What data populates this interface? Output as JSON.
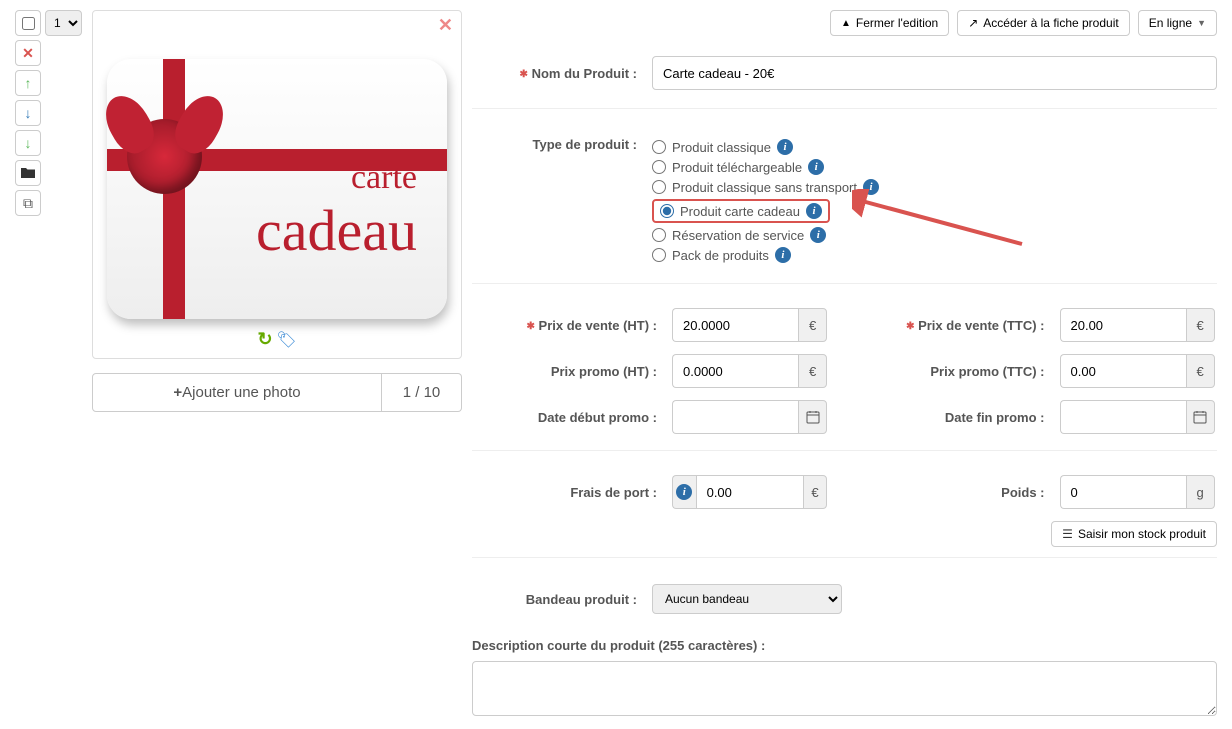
{
  "side": {
    "order_value": "1",
    "delete_icon": "✕",
    "up_icon": "↑",
    "down_icon": "↓",
    "down2_icon": "↓",
    "folder_icon": "■",
    "copy_icon": "⧉"
  },
  "toolbar": {
    "close_label": "Fermer l'edition",
    "goto_label": "Accéder à la fiche produit",
    "status_label": "En ligne"
  },
  "gallery": {
    "carte_text": "carte",
    "cadeau_text": "cadeau",
    "add_photo_label": "Ajouter une photo",
    "counter": "1 / 10"
  },
  "fields": {
    "name_label": "Nom du Produit :",
    "name_value": "Carte cadeau - 20€",
    "type_label": "Type de produit :",
    "radios": {
      "classic": "Produit classique",
      "download": "Produit téléchargeable",
      "notransport": "Produit classique sans transport",
      "giftcard": "Produit carte cadeau",
      "reservation": "Réservation de service",
      "pack": "Pack de produits"
    },
    "price_ht_label": "Prix de vente (HT) :",
    "price_ht_value": "20.0000",
    "price_ttc_label": "Prix de vente (TTC) :",
    "price_ttc_value": "20.00",
    "promo_ht_label": "Prix promo (HT) :",
    "promo_ht_value": "0.0000",
    "promo_ttc_label": "Prix promo (TTC) :",
    "promo_ttc_value": "0.00",
    "date_start_label": "Date début promo :",
    "date_start_value": "",
    "date_end_label": "Date fin promo :",
    "date_end_value": "",
    "shipping_label": "Frais de port :",
    "shipping_value": "0.00",
    "weight_label": "Poids :",
    "weight_value": "0",
    "weight_unit": "g",
    "currency": "€",
    "stock_label": "Saisir mon stock produit",
    "banner_label": "Bandeau produit :",
    "banner_value": "Aucun bandeau",
    "desc_label": "Description courte du produit (255 caractères) :"
  }
}
